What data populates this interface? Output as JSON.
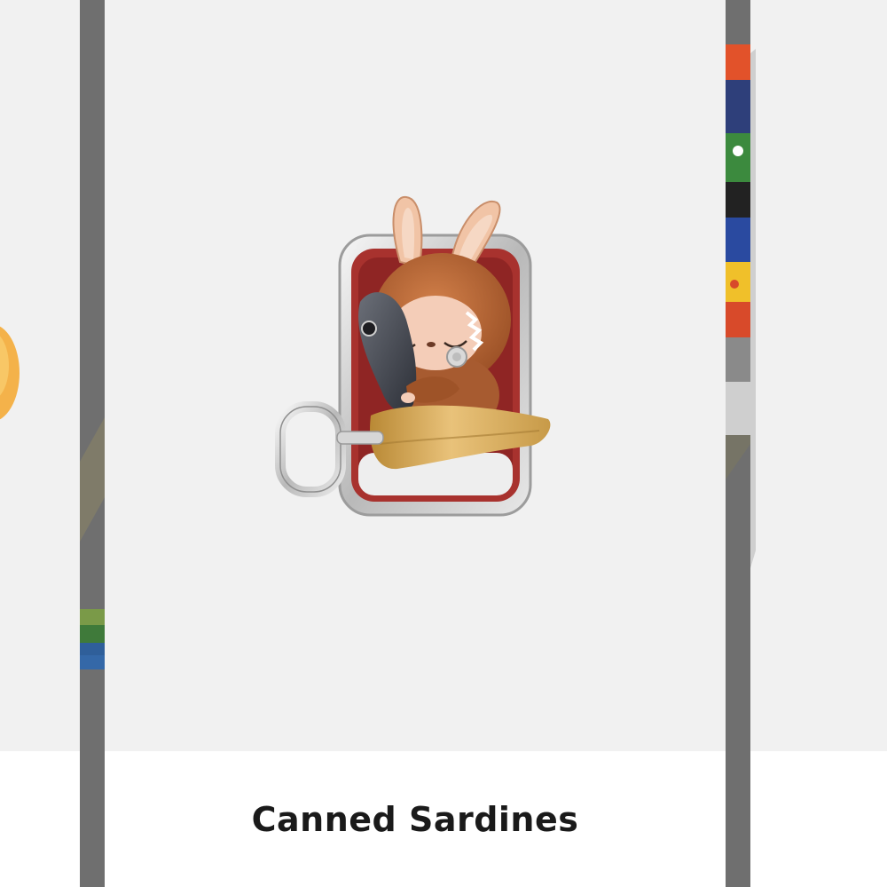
{
  "carousel": {
    "current_item": {
      "name": "Canned Sardines"
    }
  },
  "colors": {
    "card_background": "#f1f1f1",
    "caption_background": "#ffffff",
    "divider": "#6f6f6f",
    "caption_text": "#1a1a1a"
  }
}
